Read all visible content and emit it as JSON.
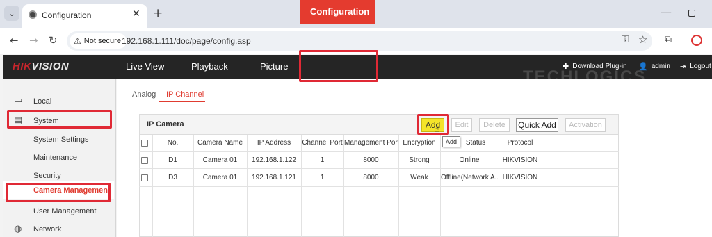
{
  "browser": {
    "tab_title": "Configuration",
    "url": "192.168.1.111/doc/page/config.asp",
    "security_label": "Not secure"
  },
  "header": {
    "brand_red": "HIK",
    "brand_white": "VISION",
    "nav": [
      "Live View",
      "Playback",
      "Picture",
      "Configuration"
    ],
    "download_plugin": "Download Plug-in",
    "user": "admin",
    "logout": "Logout",
    "watermark": "TECHLOGICS"
  },
  "sidebar": {
    "items": [
      {
        "label": "Local",
        "icon": "monitor-icon"
      },
      {
        "label": "System",
        "icon": "system-icon"
      },
      {
        "label": "System Settings"
      },
      {
        "label": "Maintenance"
      },
      {
        "label": "Security"
      },
      {
        "label": "Camera Management"
      },
      {
        "label": "User Management"
      },
      {
        "label": "Network",
        "icon": "globe-icon"
      }
    ]
  },
  "tabs": [
    "Analog",
    "IP Channel"
  ],
  "panel": {
    "title": "IP Camera",
    "buttons": {
      "add": "Add",
      "edit": "Edit",
      "delete": "Delete",
      "quick_add": "Quick Add",
      "activation": "Activation"
    },
    "tooltip": "Add",
    "columns": [
      "No.",
      "Camera Name",
      "IP Address",
      "Channel Port",
      "Management Port",
      "Encryption",
      "Status",
      "Protocol"
    ],
    "rows": [
      [
        "D1",
        "Camera 01",
        "192.168.1.122",
        "1",
        "8000",
        "Strong",
        "Online",
        "HIKVISION"
      ],
      [
        "D3",
        "Camera 01",
        "192.168.1.121",
        "1",
        "8000",
        "Weak",
        "Offline(Network A...",
        "HIKVISION"
      ]
    ]
  },
  "colors": {
    "accent": "#e43b2f",
    "highlight_box": "#e02935",
    "add_button": "#f4e42a"
  }
}
